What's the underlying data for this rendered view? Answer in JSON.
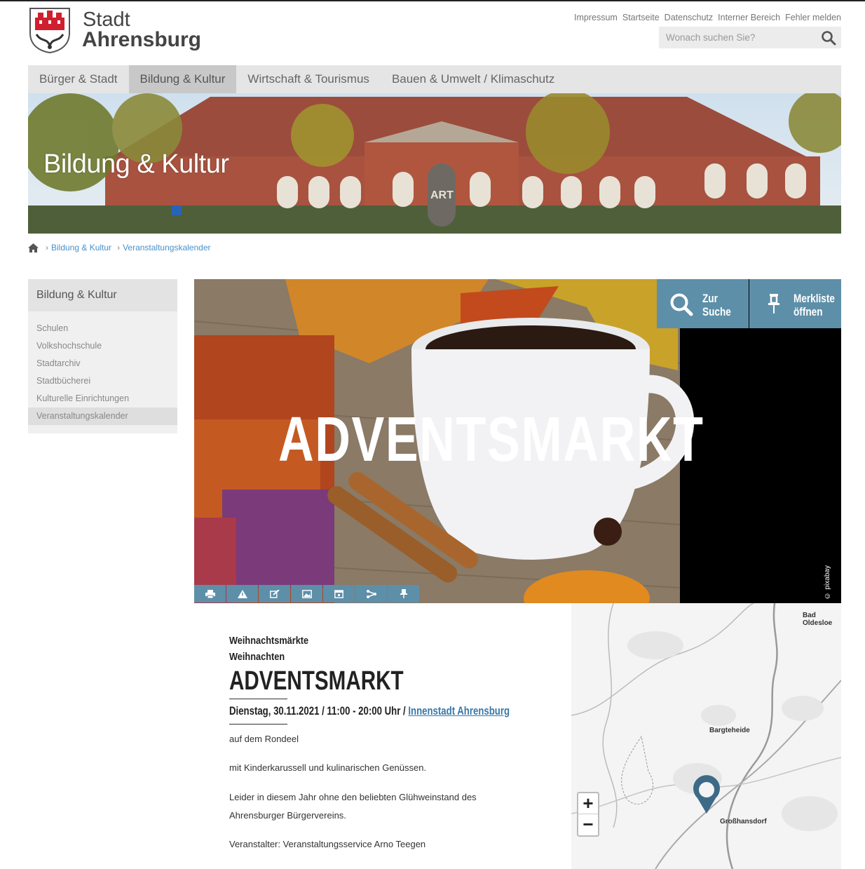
{
  "header": {
    "logo_line1": "Stadt",
    "logo_line2": "Ahrensburg",
    "meta_links": [
      "Impressum",
      "Startseite",
      "Datenschutz",
      "Interner Bereich",
      "Fehler melden"
    ],
    "search_placeholder": "Wonach suchen Sie?"
  },
  "nav": {
    "items": [
      "Bürger & Stadt",
      "Bildung & Kultur",
      "Wirtschaft & Tourismus",
      "Bauen & Umwelt / Klimaschutz"
    ],
    "active_index": 1
  },
  "hero": {
    "title": "Bildung & Kultur",
    "building_sign": "ART"
  },
  "breadcrumb": {
    "items": [
      "Bildung & Kultur",
      "Veranstaltungskalender"
    ]
  },
  "sidebar": {
    "heading": "Bildung & Kultur",
    "items": [
      "Schulen",
      "Volkshochschule",
      "Stadtarchiv",
      "Stadtbücherei",
      "Kulturelle Einrichtungen",
      "Veranstaltungskalender"
    ],
    "active_index": 5
  },
  "event_image": {
    "headline": "ADVENTSMARKT",
    "copyright": "© pixabay",
    "search_button": {
      "line1": "Zur",
      "line2": "Suche"
    },
    "pin_button": {
      "line1": "Merkliste",
      "line2": "öffnen"
    },
    "toolbar_icons": [
      "print-icon",
      "warning-icon",
      "edit-icon",
      "image-icon",
      "calendar-icon",
      "share-icon",
      "pin-icon"
    ]
  },
  "event": {
    "category1": "Weihnachtsmärkte",
    "category2": "Weihnachten",
    "title": "ADVENTSMARKT",
    "date_time": "Dienstag, 30.11.2021 / 11:00 - 20:00 Uhr / ",
    "location": "Innenstadt Ahrensburg",
    "paragraphs": [
      "auf dem Rondeel",
      "mit Kinderkarussell und kulinarischen Genüssen.",
      "Leider in diesem Jahr ohne den beliebten Glühweinstand des Ahrensburger Bürgervereins.",
      "Veranstalter: Veranstaltungsservice Arno Teegen"
    ]
  },
  "map": {
    "towns": [
      "Bad Oldesloe",
      "Bargteheide",
      "Großhansdorf"
    ],
    "zoom_in": "+",
    "zoom_out": "−"
  },
  "colors": {
    "accent": "#5d8fa9",
    "link": "#4a90c8",
    "nav_bg": "#e5e5e5"
  }
}
